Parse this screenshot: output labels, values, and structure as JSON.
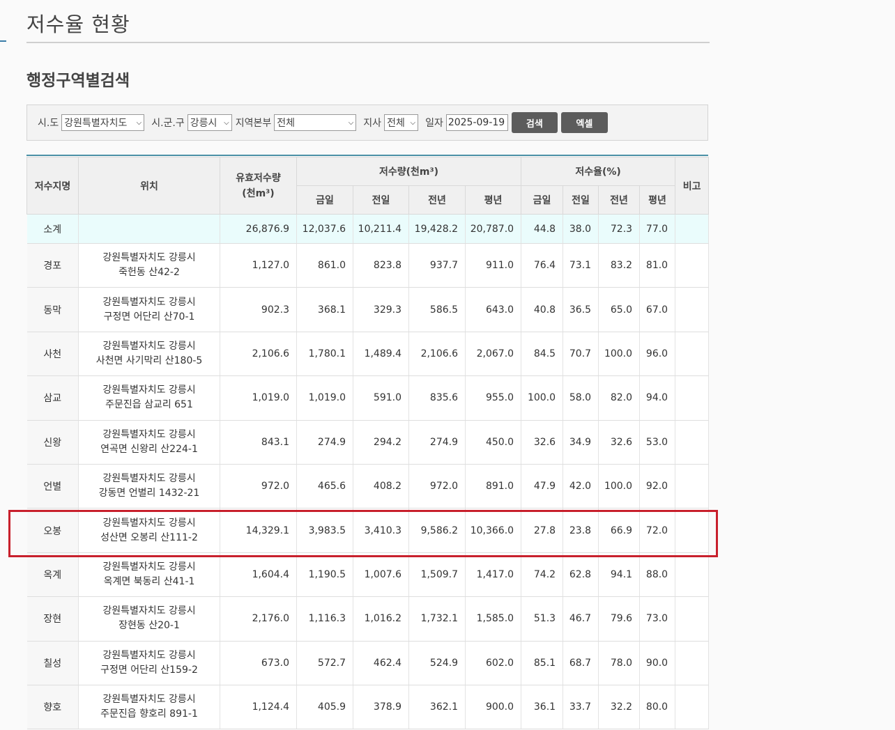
{
  "page": {
    "title": "저수율 현황",
    "section_title": "행정구역별검색"
  },
  "search": {
    "sido_label": "시.도",
    "sido_value": "강원특별자치도",
    "sigungu_label": "시.군.구",
    "sigungu_value": "강릉시",
    "region_label": "지역본부",
    "region_value": "전체",
    "branch_label": "지사",
    "branch_value": "전체",
    "date_label": "일자",
    "date_value": "2025-09-19",
    "search_button": "검색",
    "excel_button": "엑셀"
  },
  "table": {
    "headers": {
      "name": "저수지명",
      "location": "위치",
      "capacity_line1": "유효저수량",
      "capacity_line2": "(천m³)",
      "storage_group": "저수량(천m³)",
      "rate_group": "저수율(%)",
      "remarks": "비고",
      "today": "금일",
      "prev_day": "전일",
      "prev_year": "전년",
      "normal_year": "평년"
    },
    "summary": {
      "name": "소계",
      "capacity": "26,876.9",
      "storage": [
        "12,037.6",
        "10,211.4",
        "19,428.2",
        "20,787.0"
      ],
      "rate": [
        "44.8",
        "38.0",
        "72.3",
        "77.0"
      ]
    },
    "rows": [
      {
        "name": "경포",
        "loc1": "강원특별자치도 강릉시",
        "loc2": "죽헌동 산42-2",
        "capacity": "1,127.0",
        "storage": [
          "861.0",
          "823.8",
          "937.7",
          "911.0"
        ],
        "rate": [
          "76.4",
          "73.1",
          "83.2",
          "81.0"
        ]
      },
      {
        "name": "동막",
        "loc1": "강원특별자치도 강릉시",
        "loc2": "구정면 어단리 산70-1",
        "capacity": "902.3",
        "storage": [
          "368.1",
          "329.3",
          "586.5",
          "643.0"
        ],
        "rate": [
          "40.8",
          "36.5",
          "65.0",
          "67.0"
        ]
      },
      {
        "name": "사천",
        "loc1": "강원특별자치도 강릉시",
        "loc2": "사천면 사기막리 산180-5",
        "capacity": "2,106.6",
        "storage": [
          "1,780.1",
          "1,489.4",
          "2,106.6",
          "2,067.0"
        ],
        "rate": [
          "84.5",
          "70.7",
          "100.0",
          "96.0"
        ]
      },
      {
        "name": "삼교",
        "loc1": "강원특별자치도 강릉시",
        "loc2": "주문진읍 삼교리 651",
        "capacity": "1,019.0",
        "storage": [
          "1,019.0",
          "591.0",
          "835.6",
          "955.0"
        ],
        "rate": [
          "100.0",
          "58.0",
          "82.0",
          "94.0"
        ]
      },
      {
        "name": "신왕",
        "loc1": "강원특별자치도 강릉시",
        "loc2": "연곡면 신왕리 산224-1",
        "capacity": "843.1",
        "storage": [
          "274.9",
          "294.2",
          "274.9",
          "450.0"
        ],
        "rate": [
          "32.6",
          "34.9",
          "32.6",
          "53.0"
        ]
      },
      {
        "name": "언별",
        "loc1": "강원특별자치도 강릉시",
        "loc2": "강동면 언별리 1432-21",
        "capacity": "972.0",
        "storage": [
          "465.6",
          "408.2",
          "972.0",
          "891.0"
        ],
        "rate": [
          "47.9",
          "42.0",
          "100.0",
          "92.0"
        ]
      },
      {
        "name": "오봉",
        "loc1": "강원특별자치도 강릉시",
        "loc2": "성산면 오봉리 산111-2",
        "capacity": "14,329.1",
        "storage": [
          "3,983.5",
          "3,410.3",
          "9,586.2",
          "10,366.0"
        ],
        "rate": [
          "27.8",
          "23.8",
          "66.9",
          "72.0"
        ]
      },
      {
        "name": "옥계",
        "loc1": "강원특별자치도 강릉시",
        "loc2": "옥계면 북동리 산41-1",
        "capacity": "1,604.4",
        "storage": [
          "1,190.5",
          "1,007.6",
          "1,509.7",
          "1,417.0"
        ],
        "rate": [
          "74.2",
          "62.8",
          "94.1",
          "88.0"
        ]
      },
      {
        "name": "장현",
        "loc1": "강원특별자치도 강릉시",
        "loc2": "장현동 산20-1",
        "capacity": "2,176.0",
        "storage": [
          "1,116.3",
          "1,016.2",
          "1,732.1",
          "1,585.0"
        ],
        "rate": [
          "51.3",
          "46.7",
          "79.6",
          "73.0"
        ]
      },
      {
        "name": "칠성",
        "loc1": "강원특별자치도 강릉시",
        "loc2": "구정면 어단리 산159-2",
        "capacity": "673.0",
        "storage": [
          "572.7",
          "462.4",
          "524.9",
          "602.0"
        ],
        "rate": [
          "85.1",
          "68.7",
          "78.0",
          "90.0"
        ]
      },
      {
        "name": "향호",
        "loc1": "강원특별자치도 강릉시",
        "loc2": "주문진읍 향호리 891-1",
        "capacity": "1,124.4",
        "storage": [
          "405.9",
          "378.9",
          "362.1",
          "900.0"
        ],
        "rate": [
          "36.1",
          "33.7",
          "32.2",
          "80.0"
        ]
      }
    ]
  },
  "colors": {
    "highlight": "#c8202c",
    "summary_bg": "#eafcfc",
    "button_bg": "#5c5c5c",
    "table_rule": "#4a90a6"
  }
}
